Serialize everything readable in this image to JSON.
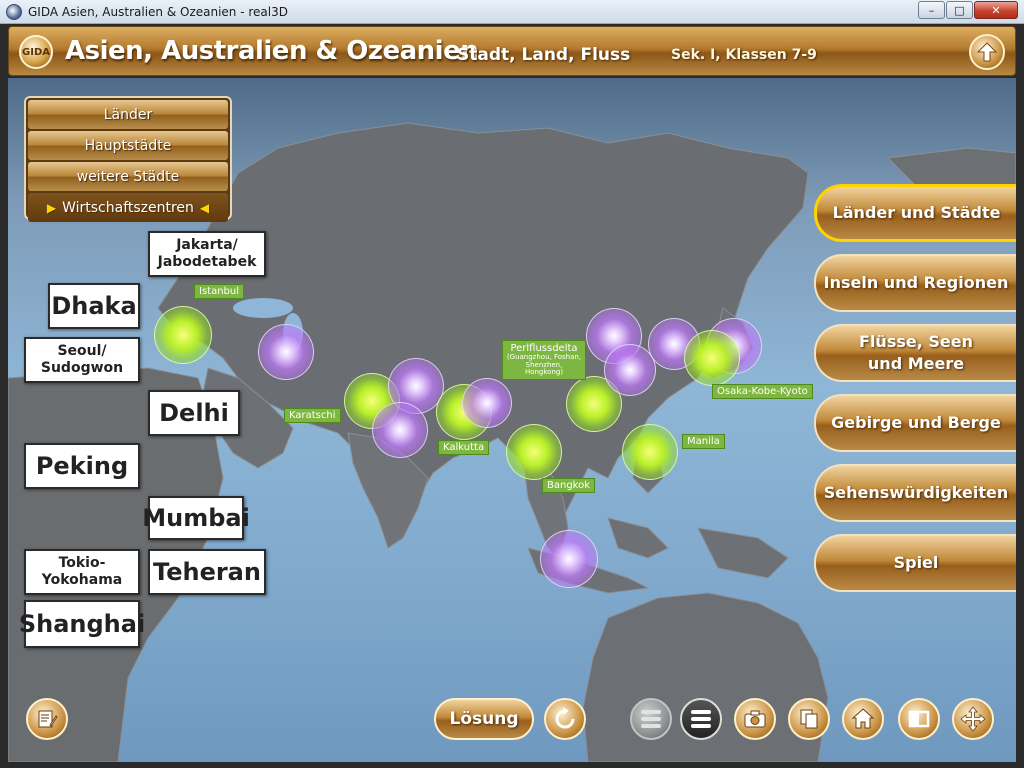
{
  "window": {
    "title": "GIDA Asien, Australien & Ozeanien - real3D",
    "min_label": "–",
    "max_label": "□",
    "close_label": "✕"
  },
  "header": {
    "logo_text": "GIDA",
    "title": "Asien, Australien & Ozeanien",
    "subtitle": "Stadt, Land, Fluss",
    "level": "Sek. I, Klassen 7-9"
  },
  "category_menu": {
    "items": [
      "Länder",
      "Hauptstädte",
      "weitere Städte",
      "Wirtschaftszentren"
    ],
    "active": "Wirtschaftszentren",
    "arrow_left": "▶",
    "arrow_right": "◀"
  },
  "cards": {
    "jakarta": "Jakarta/ Jabodetabek",
    "dhaka": "Dhaka",
    "seoul": "Seoul/ Sudogwon",
    "delhi": "Delhi",
    "peking": "Peking",
    "mumbai": "Mumbai",
    "tokio": "Tokio- Yokohama",
    "teheran": "Teheran",
    "shanghai": "Shanghai"
  },
  "map_labels": {
    "istanbul": "Istanbul",
    "karatschi": "Karatschi",
    "kalkutta": "Kalkutta",
    "perlfluss_title": "Perlflussdelta",
    "perlfluss_detail": "(Guangzhou, Foshan, Shenzhen, Hongkong)",
    "bangkok": "Bangkok",
    "manila": "Manila",
    "osaka": "Osaka-Kobe-Kyoto"
  },
  "topics": [
    "Länder und Städte",
    "Inseln und Regionen",
    "Flüsse, Seen und Meere",
    "Gebirge und Berge",
    "Sehenswürdigkeiten",
    "Spiel"
  ],
  "active_topic": "Länder und Städte",
  "toolbar": {
    "solution_label": "Lösung"
  },
  "colors": {
    "accent_gold": "#b37a2d",
    "active_border": "#ffd200",
    "marker_green": "#b9f02a",
    "marker_purple": "#be78fa",
    "label_green": "#7db741"
  }
}
